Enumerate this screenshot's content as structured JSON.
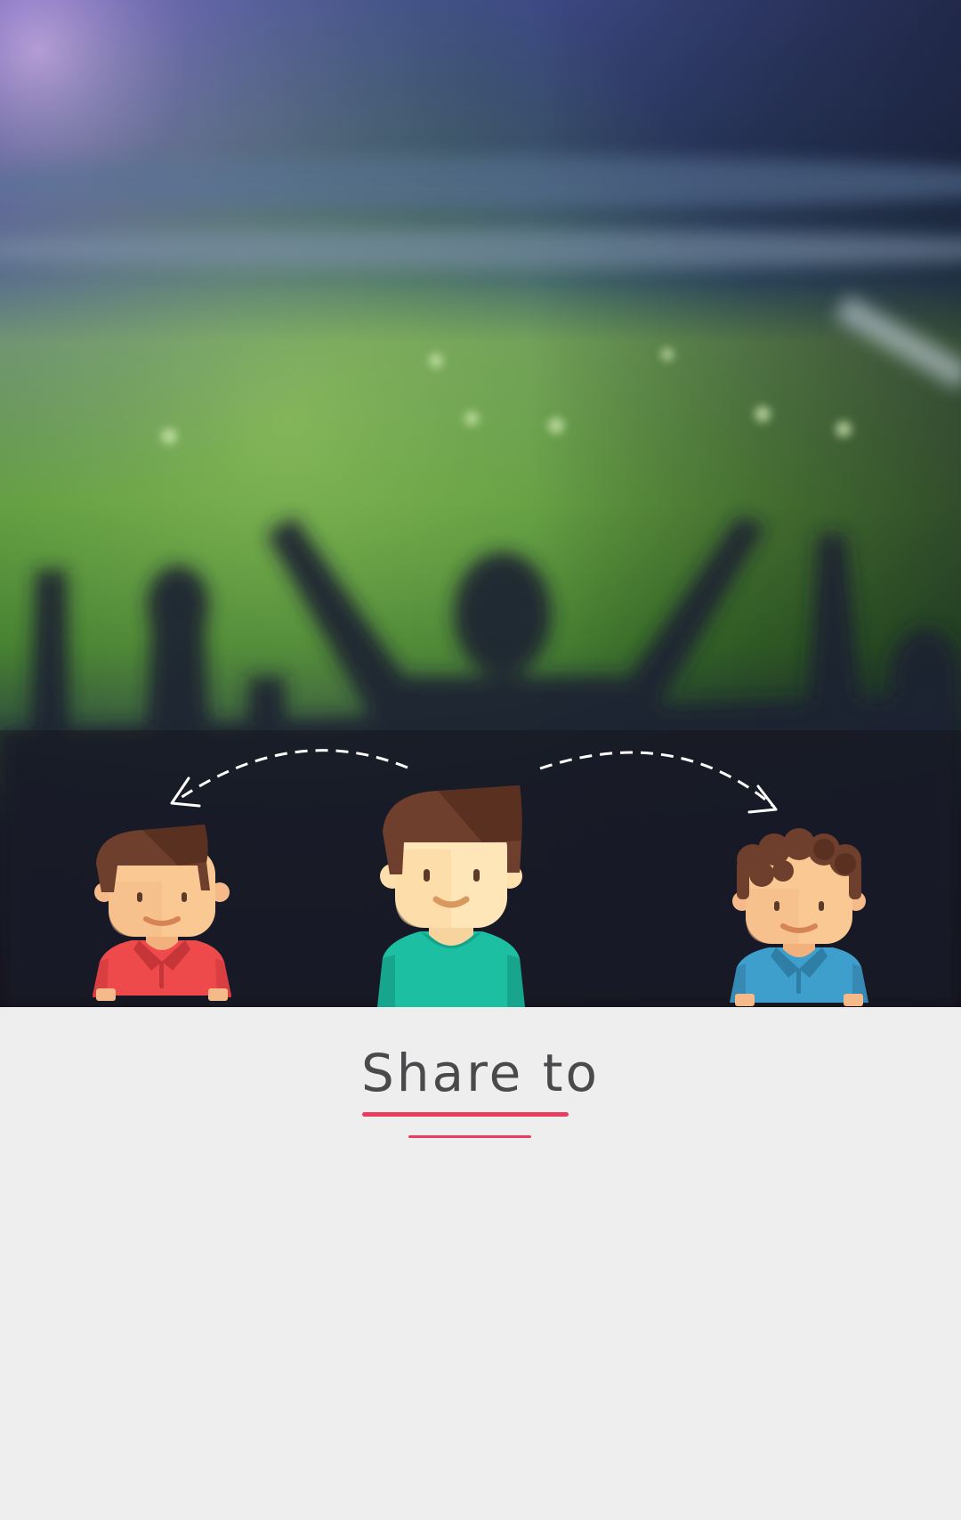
{
  "share": {
    "title": "Share to"
  },
  "colors": {
    "accent": "#ec3b61",
    "background": "#eeeeef",
    "title_text": "#4a4a4d",
    "shirt_left": "#ef4a4b",
    "shirt_center": "#1dbfa2",
    "shirt_right": "#3e9fcc"
  },
  "illustration": {
    "background": "stadium-crowd-photo",
    "people": [
      "friend-left-avatar",
      "user-center-avatar",
      "friend-right-avatar"
    ],
    "arrows": [
      "share-arrow-left-icon",
      "share-arrow-right-icon"
    ]
  }
}
